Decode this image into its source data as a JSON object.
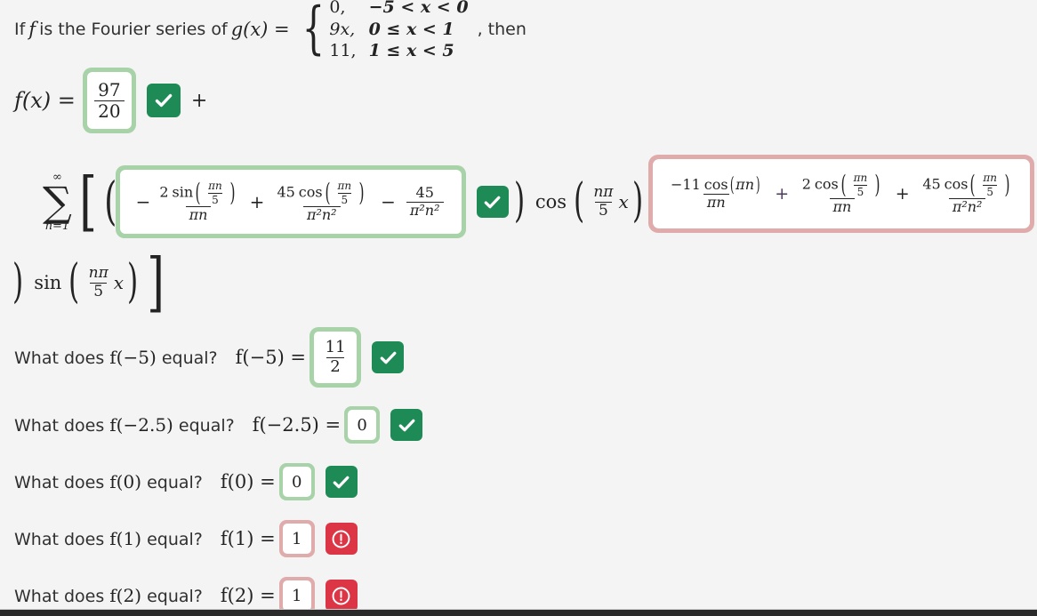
{
  "problem": {
    "lead": "If",
    "f_symbol": "f",
    "lead2": "is the Fourier series of",
    "g_symbol": "g(x) =",
    "cases": [
      {
        "value": "0,",
        "domain": "−5 < x < 0"
      },
      {
        "value": "9x,",
        "domain": "0 ≤ x < 1"
      },
      {
        "value": "11,",
        "domain": "1 ≤ x < 5"
      }
    ],
    "then": ", then"
  },
  "fx_line": {
    "lhs": "f(x) =",
    "a0_numerator": "97",
    "a0_denominator": "20",
    "a0_status": "correct",
    "plus": "+"
  },
  "series": {
    "sigma": "∑",
    "upper_limit": "∞",
    "lower_limit": "n=1",
    "open_bracket": "[",
    "open_paren": "(",
    "cosine_box": {
      "status": "correct",
      "terms": [
        {
          "sign": "−",
          "numerator": "2 sin(πn/5)",
          "num_coeff": "2",
          "func": "sin",
          "arg_num": "πn",
          "arg_den": "5",
          "denominator": "πn"
        },
        {
          "sign": "+",
          "num_coeff": "45",
          "func": "cos",
          "arg_num": "πn",
          "arg_den": "5",
          "denominator": "π²n²"
        },
        {
          "sign": "−",
          "num_coeff": "45",
          "func": "",
          "arg_num": "",
          "arg_den": "",
          "denominator": "π²n²"
        }
      ]
    },
    "cos_factor": "cos",
    "cos_arg_num": "nπ",
    "cos_arg_den": "5",
    "cos_arg_var": "x",
    "middle_plus": "+",
    "sine_box": {
      "status": "incorrect",
      "terms": [
        {
          "sign": "",
          "num_coeff": "−11",
          "func": "cos",
          "arg": "πn",
          "denominator": "πn"
        },
        {
          "sign": "+",
          "num_coeff": "2",
          "func": "cos",
          "arg_num": "πn",
          "arg_den": "5",
          "denominator": "πn"
        },
        {
          "sign": "+",
          "num_coeff": "45",
          "func": "cos",
          "arg_num": "πn",
          "arg_den": "5",
          "denominator": "π²n²"
        }
      ]
    },
    "close_paren": ")",
    "sin_factor": "sin",
    "sin_arg_num": "nπ",
    "sin_arg_den": "5",
    "sin_arg_var": "x",
    "close_bracket": "]"
  },
  "questions": [
    {
      "prompt": "What does f(−5) equal?",
      "prompt_pre": "What does",
      "prompt_f": "f(−5)",
      "prompt_post": "equal?",
      "lhs": "f(−5) =",
      "answer_type": "fraction",
      "numerator": "11",
      "denominator": "2",
      "status": "correct"
    },
    {
      "prompt": "What does f(−2.5) equal?",
      "prompt_pre": "What does",
      "prompt_f": "f(−2.5)",
      "prompt_post": "equal?",
      "lhs": "f(−2.5) =",
      "answer_type": "scalar",
      "value": "0",
      "status": "correct"
    },
    {
      "prompt": "What does f(0) equal?",
      "prompt_pre": "What does",
      "prompt_f": "f(0)",
      "prompt_post": "equal?",
      "lhs": "f(0) =",
      "answer_type": "scalar",
      "value": "0",
      "status": "correct"
    },
    {
      "prompt": "What does f(1) equal?",
      "prompt_pre": "What does",
      "prompt_f": "f(1)",
      "prompt_post": "equal?",
      "lhs": "f(1) =",
      "answer_type": "scalar",
      "value": "1",
      "status": "incorrect"
    },
    {
      "prompt": "What does f(2) equal?",
      "prompt_pre": "What does",
      "prompt_f": "f(2)",
      "prompt_post": "equal?",
      "lhs": "f(2) =",
      "answer_type": "scalar",
      "value": "1",
      "status": "incorrect"
    }
  ],
  "colors": {
    "page_background": "#f4f4f4",
    "correct_border": "#a8d2a8",
    "incorrect_border": "#e0abab",
    "correct_badge": "#1e8a55",
    "incorrect_badge": "#dc3545",
    "text": "#303030",
    "math_text": "#232323"
  },
  "icons": {
    "correct": "check-icon",
    "incorrect": "exclamation-circle-icon"
  }
}
